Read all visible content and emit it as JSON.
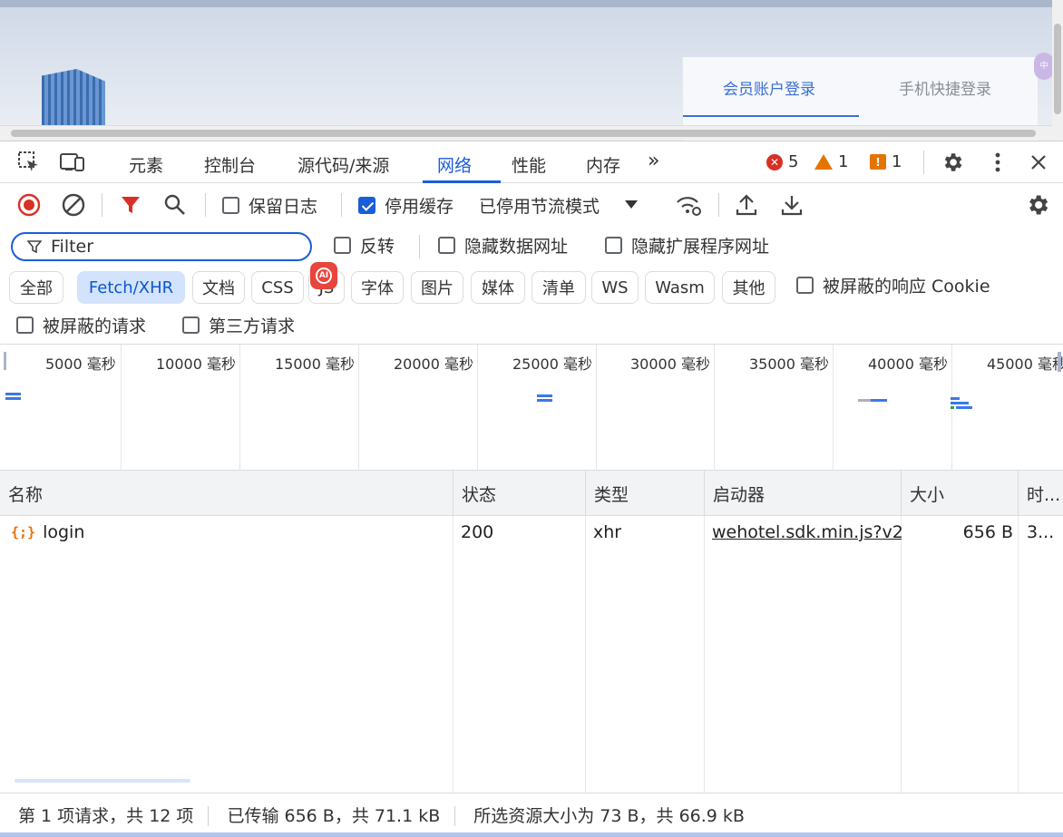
{
  "page": {
    "login_tabs": [
      "会员账户登录",
      "手机快捷登录"
    ],
    "side_badge": "中"
  },
  "devtools": {
    "tabs": [
      "元素",
      "控制台",
      "源代码/来源",
      "网络",
      "性能",
      "内存"
    ],
    "more_tabs": "»",
    "active_tab": "网络",
    "errors": "5",
    "warnings": "1",
    "issues": "1",
    "toolbar": {
      "preserve_log": "保留日志",
      "disable_cache": "停用缓存",
      "throttling": "已停用节流模式"
    },
    "filter": {
      "placeholder": "Filter",
      "invert": "反转",
      "hide_data_urls": "隐藏数据网址",
      "hide_extension_urls": "隐藏扩展程序网址"
    },
    "types": [
      "全部",
      "Fetch/XHR",
      "文档",
      "CSS",
      "JS",
      "字体",
      "图片",
      "媒体",
      "清单",
      "WS",
      "Wasm",
      "其他"
    ],
    "active_type": "Fetch/XHR",
    "blocked_cookies": "被屏蔽的响应 Cookie",
    "blocked_requests": "被屏蔽的请求",
    "third_party": "第三方请求",
    "timeline_labels": [
      "5000 毫秒",
      "10000 毫秒",
      "15000 毫秒",
      "20000 毫秒",
      "25000 毫秒",
      "30000 毫秒",
      "35000 毫秒",
      "40000 毫秒",
      "45000 毫秒"
    ],
    "columns": [
      "名称",
      "状态",
      "类型",
      "启动器",
      "大小",
      "时..."
    ],
    "rows": [
      {
        "name": "login",
        "status": "200",
        "type": "xhr",
        "initiator": "wehotel.sdk.min.js?v2",
        "size": "656 B",
        "time": "3..."
      }
    ],
    "status": {
      "requests": "第 1 项请求，共 12 项",
      "transferred": "已传输 656 B，共 71.1 kB",
      "resources": "所选资源大小为 73 B，共 66.9 kB"
    }
  }
}
